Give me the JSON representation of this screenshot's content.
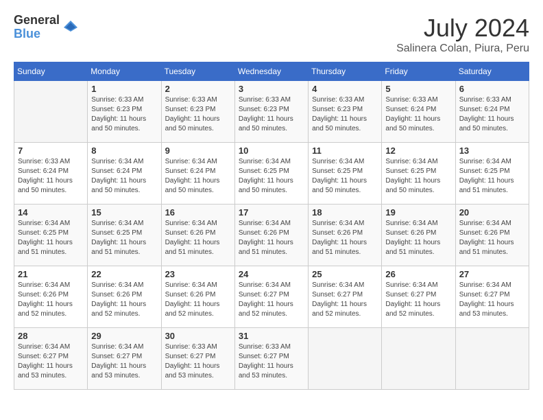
{
  "logo": {
    "general": "General",
    "blue": "Blue"
  },
  "title": {
    "month_year": "July 2024",
    "location": "Salinera Colan, Piura, Peru"
  },
  "days_of_week": [
    "Sunday",
    "Monday",
    "Tuesday",
    "Wednesday",
    "Thursday",
    "Friday",
    "Saturday"
  ],
  "weeks": [
    [
      {
        "day": "",
        "info": ""
      },
      {
        "day": "1",
        "info": "Sunrise: 6:33 AM\nSunset: 6:23 PM\nDaylight: 11 hours\nand 50 minutes."
      },
      {
        "day": "2",
        "info": "Sunrise: 6:33 AM\nSunset: 6:23 PM\nDaylight: 11 hours\nand 50 minutes."
      },
      {
        "day": "3",
        "info": "Sunrise: 6:33 AM\nSunset: 6:23 PM\nDaylight: 11 hours\nand 50 minutes."
      },
      {
        "day": "4",
        "info": "Sunrise: 6:33 AM\nSunset: 6:23 PM\nDaylight: 11 hours\nand 50 minutes."
      },
      {
        "day": "5",
        "info": "Sunrise: 6:33 AM\nSunset: 6:24 PM\nDaylight: 11 hours\nand 50 minutes."
      },
      {
        "day": "6",
        "info": "Sunrise: 6:33 AM\nSunset: 6:24 PM\nDaylight: 11 hours\nand 50 minutes."
      }
    ],
    [
      {
        "day": "7",
        "info": "Sunrise: 6:33 AM\nSunset: 6:24 PM\nDaylight: 11 hours\nand 50 minutes."
      },
      {
        "day": "8",
        "info": "Sunrise: 6:34 AM\nSunset: 6:24 PM\nDaylight: 11 hours\nand 50 minutes."
      },
      {
        "day": "9",
        "info": "Sunrise: 6:34 AM\nSunset: 6:24 PM\nDaylight: 11 hours\nand 50 minutes."
      },
      {
        "day": "10",
        "info": "Sunrise: 6:34 AM\nSunset: 6:25 PM\nDaylight: 11 hours\nand 50 minutes."
      },
      {
        "day": "11",
        "info": "Sunrise: 6:34 AM\nSunset: 6:25 PM\nDaylight: 11 hours\nand 50 minutes."
      },
      {
        "day": "12",
        "info": "Sunrise: 6:34 AM\nSunset: 6:25 PM\nDaylight: 11 hours\nand 50 minutes."
      },
      {
        "day": "13",
        "info": "Sunrise: 6:34 AM\nSunset: 6:25 PM\nDaylight: 11 hours\nand 51 minutes."
      }
    ],
    [
      {
        "day": "14",
        "info": "Sunrise: 6:34 AM\nSunset: 6:25 PM\nDaylight: 11 hours\nand 51 minutes."
      },
      {
        "day": "15",
        "info": "Sunrise: 6:34 AM\nSunset: 6:25 PM\nDaylight: 11 hours\nand 51 minutes."
      },
      {
        "day": "16",
        "info": "Sunrise: 6:34 AM\nSunset: 6:26 PM\nDaylight: 11 hours\nand 51 minutes."
      },
      {
        "day": "17",
        "info": "Sunrise: 6:34 AM\nSunset: 6:26 PM\nDaylight: 11 hours\nand 51 minutes."
      },
      {
        "day": "18",
        "info": "Sunrise: 6:34 AM\nSunset: 6:26 PM\nDaylight: 11 hours\nand 51 minutes."
      },
      {
        "day": "19",
        "info": "Sunrise: 6:34 AM\nSunset: 6:26 PM\nDaylight: 11 hours\nand 51 minutes."
      },
      {
        "day": "20",
        "info": "Sunrise: 6:34 AM\nSunset: 6:26 PM\nDaylight: 11 hours\nand 51 minutes."
      }
    ],
    [
      {
        "day": "21",
        "info": "Sunrise: 6:34 AM\nSunset: 6:26 PM\nDaylight: 11 hours\nand 52 minutes."
      },
      {
        "day": "22",
        "info": "Sunrise: 6:34 AM\nSunset: 6:26 PM\nDaylight: 11 hours\nand 52 minutes."
      },
      {
        "day": "23",
        "info": "Sunrise: 6:34 AM\nSunset: 6:26 PM\nDaylight: 11 hours\nand 52 minutes."
      },
      {
        "day": "24",
        "info": "Sunrise: 6:34 AM\nSunset: 6:27 PM\nDaylight: 11 hours\nand 52 minutes."
      },
      {
        "day": "25",
        "info": "Sunrise: 6:34 AM\nSunset: 6:27 PM\nDaylight: 11 hours\nand 52 minutes."
      },
      {
        "day": "26",
        "info": "Sunrise: 6:34 AM\nSunset: 6:27 PM\nDaylight: 11 hours\nand 52 minutes."
      },
      {
        "day": "27",
        "info": "Sunrise: 6:34 AM\nSunset: 6:27 PM\nDaylight: 11 hours\nand 53 minutes."
      }
    ],
    [
      {
        "day": "28",
        "info": "Sunrise: 6:34 AM\nSunset: 6:27 PM\nDaylight: 11 hours\nand 53 minutes."
      },
      {
        "day": "29",
        "info": "Sunrise: 6:34 AM\nSunset: 6:27 PM\nDaylight: 11 hours\nand 53 minutes."
      },
      {
        "day": "30",
        "info": "Sunrise: 6:33 AM\nSunset: 6:27 PM\nDaylight: 11 hours\nand 53 minutes."
      },
      {
        "day": "31",
        "info": "Sunrise: 6:33 AM\nSunset: 6:27 PM\nDaylight: 11 hours\nand 53 minutes."
      },
      {
        "day": "",
        "info": ""
      },
      {
        "day": "",
        "info": ""
      },
      {
        "day": "",
        "info": ""
      }
    ]
  ]
}
